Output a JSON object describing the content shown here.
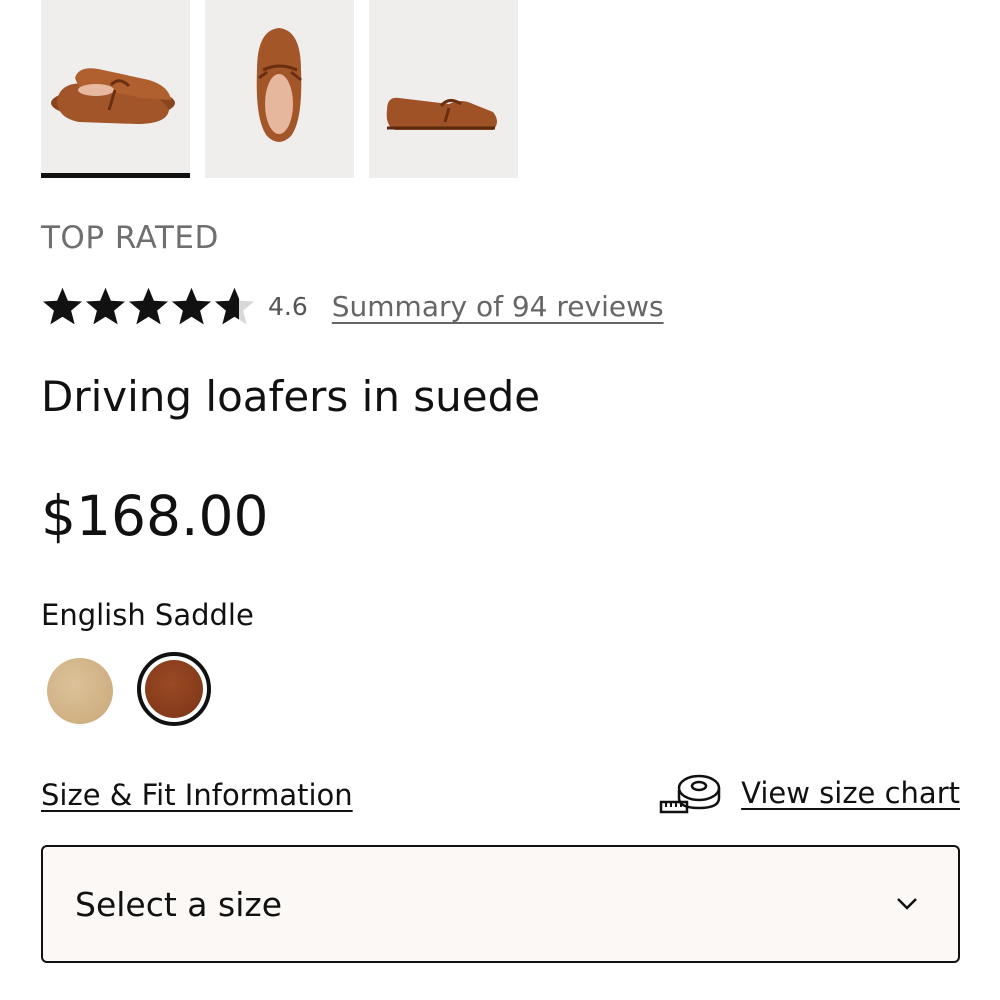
{
  "gallery": {
    "thumbnails": [
      {
        "alt": "shoe-pair-side-view",
        "active": true
      },
      {
        "alt": "shoe-top-view",
        "active": false
      },
      {
        "alt": "shoe-profile-view",
        "active": false
      }
    ]
  },
  "product": {
    "badge": "TOP RATED",
    "rating": {
      "value": "4.6",
      "stars": 4.6,
      "max": 5,
      "reviews_link": "Summary of 94 reviews"
    },
    "title": "Driving loafers in suede",
    "price": "$168.00",
    "color": {
      "selected_name": "English Saddle",
      "swatches": [
        {
          "name": "tan",
          "hex": "#d2b68a",
          "selected": false
        },
        {
          "name": "English Saddle",
          "hex": "#8b3f1e",
          "selected": true
        }
      ]
    },
    "size": {
      "fit_link": "Size & Fit Information",
      "chart_link": "View size chart",
      "select_placeholder": "Select a size"
    }
  },
  "colors": {
    "text": "#111111",
    "muted": "#6f6f6f",
    "thumb_bg": "#efeeec",
    "select_bg": "#fcf8f5"
  }
}
